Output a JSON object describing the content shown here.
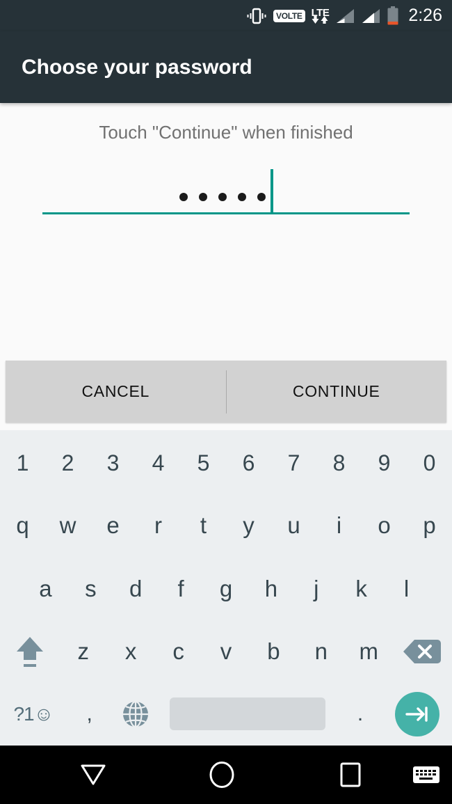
{
  "status_bar": {
    "icons": [
      "vibrate-icon",
      "volte-badge",
      "lte-icon",
      "signal-bars-1-icon",
      "signal-bars-2-icon",
      "battery-icon"
    ],
    "volte_label": "VOLTE",
    "lte_label": "LTE",
    "clock": "2:26",
    "background": "#263238",
    "foreground": "#ffffff",
    "battery_low_color": "#e8552a"
  },
  "app_bar": {
    "title": "Choose your password",
    "background": "#263238"
  },
  "content": {
    "hint": "Touch \"Continue\" when finished",
    "password_field": {
      "masked_value": "•••••",
      "dot_count": 5,
      "caret_visible": true,
      "accent_color": "#009688"
    },
    "background": "#fafafa"
  },
  "action_bar": {
    "cancel_label": "CANCEL",
    "continue_label": "CONTINUE",
    "background": "#d2d2d2"
  },
  "keyboard": {
    "background": "#eceff1",
    "key_color": "#37474f",
    "rows": {
      "numbers": [
        "1",
        "2",
        "3",
        "4",
        "5",
        "6",
        "7",
        "8",
        "9",
        "0"
      ],
      "qwerty": [
        "q",
        "w",
        "e",
        "r",
        "t",
        "y",
        "u",
        "i",
        "o",
        "p"
      ],
      "asdf": [
        "a",
        "s",
        "d",
        "f",
        "g",
        "h",
        "j",
        "k",
        "l"
      ],
      "zxcv": [
        "z",
        "x",
        "c",
        "v",
        "b",
        "n",
        "m"
      ]
    },
    "shift_key": "shift-icon",
    "backspace_key": "backspace-icon",
    "symbols_key": "?1☺",
    "comma_key": ",",
    "globe_key": "globe-icon",
    "space_key": "spacebar",
    "period_key": ".",
    "enter_key": "tab-next-icon",
    "enter_color": "#45b2a8",
    "spacebar_color": "#d3d7da"
  },
  "nav_bar": {
    "background": "#000000",
    "back_icon": "back-down-triangle-icon",
    "home_icon": "home-circle-icon",
    "recents_icon": "recents-square-icon",
    "keyboard_icon": "keyboard-switcher-icon"
  }
}
